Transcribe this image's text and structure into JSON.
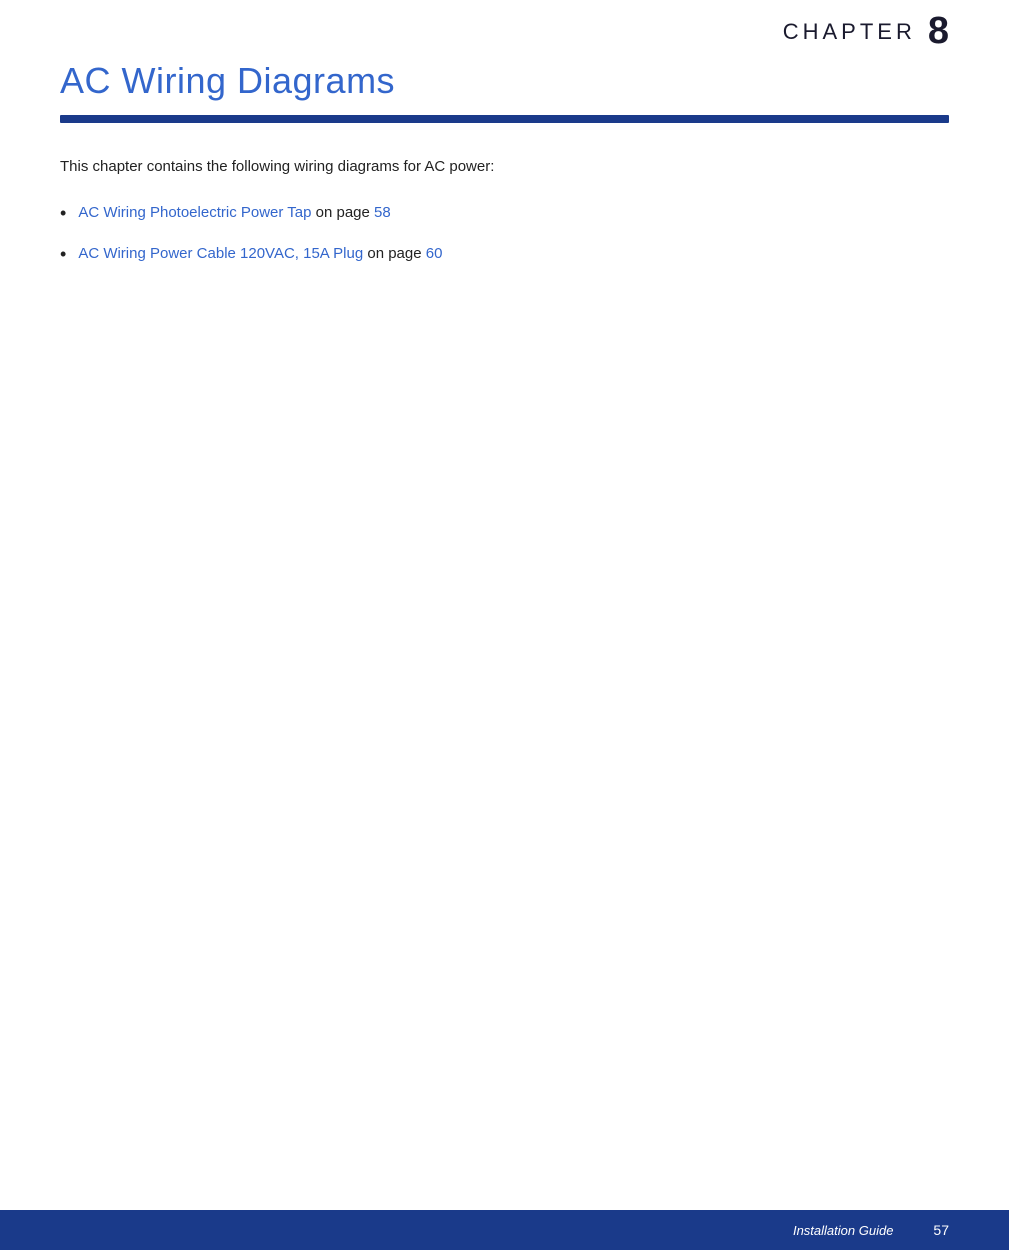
{
  "header": {
    "chapter_label": "CHAPTER",
    "chapter_number": "8"
  },
  "page_title": "AC Wiring Diagrams",
  "divider": true,
  "content": {
    "intro_text": "This chapter contains the following wiring diagrams for AC power:",
    "bullet_items": [
      {
        "link_text": "AC Wiring Photoelectric Power Tap",
        "middle_text": " on page ",
        "page_number": "58"
      },
      {
        "link_text": "AC Wiring Power Cable 120VAC, 15A Plug",
        "middle_text": " on page ",
        "page_number": "60"
      }
    ]
  },
  "footer": {
    "label": "Installation Guide",
    "page_number": "57"
  }
}
